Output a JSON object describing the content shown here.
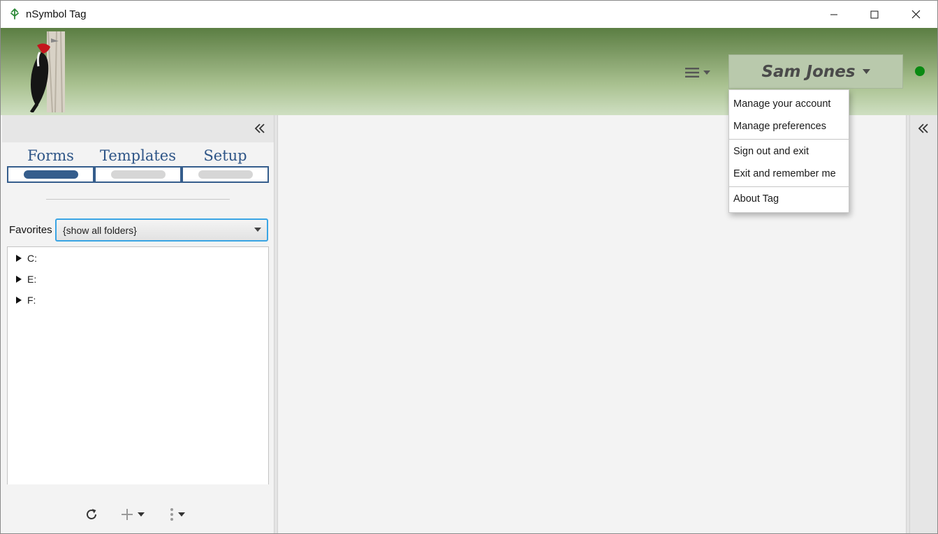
{
  "window": {
    "title": "nSymbol Tag",
    "controls": [
      "minimize",
      "maximize",
      "close"
    ]
  },
  "header": {
    "logo": "pileated-woodpecker-logo",
    "menu_icon": "hamburger-menu-icon",
    "user_name": "Sam Jones",
    "status": {
      "label": "online",
      "color": "#0a8a12"
    },
    "colors": {
      "gradient_top": "#5b7e43",
      "gradient_bottom": "#cfdfc2"
    }
  },
  "user_menu": {
    "items": [
      {
        "label": "Manage your account"
      },
      {
        "label": "Manage preferences"
      },
      {
        "label": "Sign out and exit"
      },
      {
        "label": "Exit and remember me"
      },
      {
        "label": "About Tag"
      }
    ]
  },
  "left_panel": {
    "collapse_icon": "double-chevron-left-icon",
    "tabs": [
      {
        "label": "Forms",
        "active": true
      },
      {
        "label": "Templates",
        "active": false
      },
      {
        "label": "Setup",
        "active": false
      }
    ],
    "favorites": {
      "label": "Favorites",
      "selected": "{show all folders}"
    },
    "tree": [
      {
        "label": "C:"
      },
      {
        "label": "E:"
      },
      {
        "label": "F:"
      }
    ],
    "bottom_bar": [
      "refresh-icon",
      "add-icon",
      "more-vertical-icon"
    ]
  },
  "right_panel": {
    "collapse_icon": "double-chevron-left-icon"
  },
  "accent_colors": {
    "tab_blue": "#355d8c",
    "focus_blue": "#39a4e4"
  }
}
